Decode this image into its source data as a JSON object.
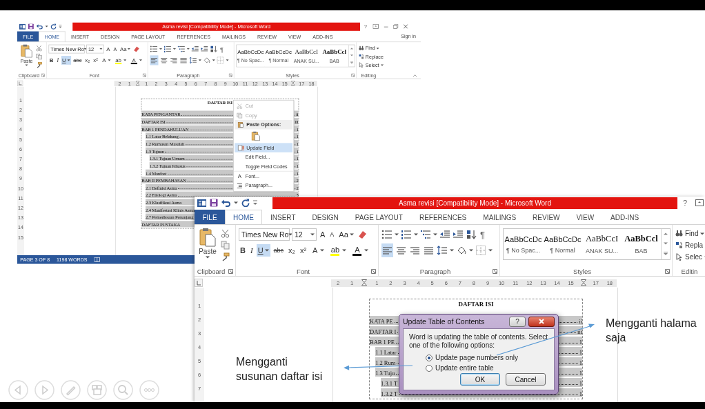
{
  "windows": [
    {
      "title": "Asma revisi [Compatibility Mode] - Microsoft Word",
      "help": "?",
      "sign_in": "Sign in",
      "tabs": [
        {
          "label": "FILE",
          "kind": "file",
          "selected": false
        },
        {
          "label": "HOME",
          "kind": "tab",
          "selected": true
        },
        {
          "label": "INSERT",
          "kind": "tab",
          "selected": false
        },
        {
          "label": "DESIGN",
          "kind": "tab",
          "selected": false
        },
        {
          "label": "PAGE LAYOUT",
          "kind": "tab",
          "selected": false
        },
        {
          "label": "REFERENCES",
          "kind": "tab",
          "selected": false
        },
        {
          "label": "MAILINGS",
          "kind": "tab",
          "selected": false
        },
        {
          "label": "REVIEW",
          "kind": "tab",
          "selected": false
        },
        {
          "label": "VIEW",
          "kind": "tab",
          "selected": false
        },
        {
          "label": "ADD-INS",
          "kind": "tab",
          "selected": false
        }
      ],
      "ribbon": {
        "paste": "Paste",
        "font_name": "Times New Ro",
        "font_size": "12",
        "size_buttons": [
          "A",
          "A"
        ],
        "case_button": "Aa",
        "format_buttons": [
          {
            "label": "B",
            "kind": "bold",
            "selected": false
          },
          {
            "label": "I",
            "kind": "italic",
            "selected": false
          },
          {
            "label": "U",
            "kind": "underline",
            "selected": true
          },
          {
            "label": "abc",
            "kind": "strike",
            "selected": false
          },
          {
            "label": "x₂",
            "kind": "subscript",
            "selected": false
          },
          {
            "label": "x²",
            "kind": "superscript",
            "selected": false
          }
        ],
        "color_buttons": [
          {
            "label": "A",
            "kind": "text-effect"
          },
          {
            "label": "ab",
            "kind": "highlight"
          },
          {
            "label": "A",
            "kind": "font-color"
          }
        ],
        "align_buttons": [
          {
            "kind": "left",
            "selected": true
          },
          {
            "kind": "center",
            "selected": false
          },
          {
            "kind": "right",
            "selected": false
          },
          {
            "kind": "justify",
            "selected": false
          }
        ],
        "show_marks": "¶",
        "styles": [
          {
            "preview": "AaBbCcDc",
            "name": "¶ No Spac...",
            "kind": "body"
          },
          {
            "preview": "AaBbCcDc",
            "name": "¶ Normal",
            "kind": "body"
          },
          {
            "preview": "AaBbCcI",
            "name": "ANAK SU...",
            "kind": "heading"
          },
          {
            "preview": "AaBbCcl",
            "name": "BAB",
            "kind": "heading-bold"
          }
        ],
        "editing": [
          {
            "label": "Find",
            "kind": "find"
          },
          {
            "label": "Replace",
            "kind": "replace"
          },
          {
            "label": "Select",
            "kind": "select"
          }
        ],
        "groups": [
          "Clipboard",
          "Font",
          "Paragraph",
          "Styles",
          "Editing"
        ]
      },
      "ruler": [
        {
          "kind": "number",
          "label": "2"
        },
        {
          "kind": "number",
          "label": "1"
        },
        {
          "kind": "marker"
        },
        {
          "kind": "number",
          "label": "1"
        },
        {
          "kind": "number",
          "label": "2"
        },
        {
          "kind": "number",
          "label": "3"
        },
        {
          "kind": "number",
          "label": "4"
        },
        {
          "kind": "number",
          "label": "5"
        },
        {
          "kind": "number",
          "label": "6"
        },
        {
          "kind": "number",
          "label": "7"
        },
        {
          "kind": "number",
          "label": "8"
        },
        {
          "kind": "number",
          "label": "9"
        },
        {
          "kind": "number",
          "label": "10"
        },
        {
          "kind": "number",
          "label": "11"
        },
        {
          "kind": "number",
          "label": "12"
        },
        {
          "kind": "number",
          "label": "13"
        },
        {
          "kind": "number",
          "label": "14"
        },
        {
          "kind": "number",
          "label": "15"
        },
        {
          "kind": "marker"
        },
        {
          "kind": "number",
          "label": "17"
        },
        {
          "kind": "number",
          "label": "18"
        }
      ],
      "vruler": [
        "1",
        "2",
        "3",
        "4",
        "5",
        "6",
        "7",
        "8",
        "9",
        "10",
        "11",
        "12",
        "13",
        "14",
        "15"
      ],
      "document": {
        "heading": "DAFTAR ISI",
        "entries": [
          {
            "text": "KATA PENGANTAR",
            "page": "ii"
          },
          {
            "text": "DAFTAR ISI",
            "page": "iii"
          },
          {
            "text": "BAB 1 PENDAHULUAN",
            "page": "1",
            "children": [
              {
                "text": "1.1 Latar Belakang",
                "page": "1"
              },
              {
                "text": "1.2 Rumusan Masalah",
                "page": "1"
              },
              {
                "text": "1.3 Tujuan",
                "page": "1",
                "children": [
                  {
                    "text": "1.3.1 Tujuan Umum",
                    "page": "1"
                  },
                  {
                    "text": "1.3.2 Tujuan Khusus",
                    "page": "1"
                  }
                ]
              },
              {
                "text": "1.4 Manfaat",
                "page": "1"
              }
            ]
          },
          {
            "text": "BAB II PEMBAHASAN",
            "page": "2",
            "children": [
              {
                "text": "2.1 Definisi Asma",
                "page": "2"
              },
              {
                "text": "2.2 Etiologi Asma",
                "page": "3"
              },
              {
                "text": "2.3 Klasifikasi Asma"
              },
              {
                "text": "2.4 Manifestasi Klinis Asma"
              },
              {
                "text": "2.7 Pemeriksaan Penunjang"
              }
            ]
          },
          {
            "text": "DAFTAR PUSTAKA"
          }
        ]
      },
      "context_menu": [
        {
          "label": "Cut",
          "kind": "cut",
          "disabled": true,
          "selected": false
        },
        {
          "label": "Copy",
          "kind": "copy",
          "disabled": true,
          "selected": false
        },
        {
          "label": "Paste Options:",
          "kind": "header",
          "disabled": false,
          "selected": false
        },
        {
          "kind": "paste-option",
          "disabled": false,
          "selected": false
        },
        {
          "label": "Update Field",
          "kind": "update-field",
          "disabled": false,
          "selected": true
        },
        {
          "label": "Edit Field...",
          "kind": "edit-field",
          "disabled": false,
          "selected": false
        },
        {
          "label": "Toggle Field Codes",
          "kind": "toggle",
          "disabled": false,
          "selected": false
        },
        {
          "label": "Font...",
          "kind": "font",
          "icon_text": "A",
          "disabled": false,
          "selected": false
        },
        {
          "label": "Paragraph...",
          "kind": "paragraph",
          "disabled": false,
          "selected": false
        }
      ],
      "status_bar": {
        "page": "PAGE 3 OF 8",
        "words": "1198 WORDS"
      }
    },
    {
      "title": "Asma revisi [Compatibility Mode] - Microsoft Word",
      "help": "?",
      "tabs": [
        {
          "label": "FILE",
          "kind": "file",
          "selected": false
        },
        {
          "label": "HOME",
          "kind": "tab",
          "selected": true
        },
        {
          "label": "INSERT",
          "kind": "tab",
          "selected": false
        },
        {
          "label": "DESIGN",
          "kind": "tab",
          "selected": false
        },
        {
          "label": "PAGE LAYOUT",
          "kind": "tab",
          "selected": false
        },
        {
          "label": "REFERENCES",
          "kind": "tab",
          "selected": false
        },
        {
          "label": "MAILINGS",
          "kind": "tab",
          "selected": false
        },
        {
          "label": "REVIEW",
          "kind": "tab",
          "selected": false
        },
        {
          "label": "VIEW",
          "kind": "tab",
          "selected": false
        },
        {
          "label": "ADD-INS",
          "kind": "tab",
          "selected": false
        }
      ],
      "ribbon": {
        "paste": "Paste",
        "font_name": "Times New Ro",
        "font_size": "12",
        "size_buttons": [
          "A",
          "A"
        ],
        "case_button": "Aa",
        "format_buttons": [
          {
            "label": "B",
            "kind": "bold",
            "selected": false
          },
          {
            "label": "I",
            "kind": "italic",
            "selected": false
          },
          {
            "label": "U",
            "kind": "underline",
            "selected": true
          },
          {
            "label": "abc",
            "kind": "strike",
            "selected": false
          },
          {
            "label": "x₂",
            "kind": "subscript",
            "selected": false
          },
          {
            "label": "x²",
            "kind": "superscript",
            "selected": false
          }
        ],
        "color_buttons": [
          {
            "label": "A",
            "kind": "text-effect"
          },
          {
            "label": "ab",
            "kind": "highlight"
          },
          {
            "label": "A",
            "kind": "font-color"
          }
        ],
        "align_buttons": [
          {
            "kind": "left",
            "selected": true
          },
          {
            "kind": "center",
            "selected": false
          },
          {
            "kind": "right",
            "selected": false
          },
          {
            "kind": "justify",
            "selected": false
          }
        ],
        "show_marks": "¶",
        "styles": [
          {
            "preview": "AaBbCcDc",
            "name": "¶ No Spac...",
            "kind": "body"
          },
          {
            "preview": "AaBbCcDc",
            "name": "¶ Normal",
            "kind": "body"
          },
          {
            "preview": "AaBbCcI",
            "name": "ANAK SU...",
            "kind": "heading"
          },
          {
            "preview": "AaBbCcl",
            "name": "BAB",
            "kind": "heading-bold"
          }
        ],
        "editing": [
          {
            "label": "Find",
            "kind": "find"
          },
          {
            "label": "Repla",
            "kind": "replace"
          },
          {
            "label": "Selec",
            "kind": "select"
          }
        ],
        "groups": [
          "Clipboard",
          "Font",
          "Paragraph",
          "Styles",
          "Editin"
        ]
      },
      "ruler": [
        {
          "kind": "number",
          "label": "2"
        },
        {
          "kind": "number",
          "label": "1"
        },
        {
          "kind": "marker"
        },
        {
          "kind": "number",
          "label": "1"
        },
        {
          "kind": "number",
          "label": "2"
        },
        {
          "kind": "number",
          "label": "3"
        },
        {
          "kind": "number",
          "label": "4"
        },
        {
          "kind": "number",
          "label": "5"
        },
        {
          "kind": "number",
          "label": "6"
        },
        {
          "kind": "number",
          "label": "7"
        },
        {
          "kind": "number",
          "label": "8"
        },
        {
          "kind": "number",
          "label": "9"
        },
        {
          "kind": "number",
          "label": "10"
        },
        {
          "kind": "number",
          "label": "11"
        },
        {
          "kind": "number",
          "label": "12"
        },
        {
          "kind": "number",
          "label": "13"
        },
        {
          "kind": "number",
          "label": "14"
        },
        {
          "kind": "number",
          "label": "15"
        },
        {
          "kind": "marker"
        },
        {
          "kind": "number",
          "label": "17"
        },
        {
          "kind": "number",
          "label": "18"
        }
      ],
      "vruler": [
        "1",
        "2",
        "3",
        "4",
        "5",
        "6",
        "7"
      ],
      "document": {
        "heading": "DAFTAR ISI",
        "entries": [
          {
            "text": "KATA PE",
            "page": "ii"
          },
          {
            "text": "DAFTAR I",
            "page": "iii"
          },
          {
            "text": "BAB 1 PE",
            "page": "1",
            "children": [
              {
                "text": "1.1 Latar",
                "page": "1"
              },
              {
                "text": "1.2 Rum",
                "page": "1"
              },
              {
                "text": "1.3 Tuju",
                "page": "1",
                "children": [
                  {
                    "text": "1.3.1 T",
                    "page": "1"
                  },
                  {
                    "text": "1.3.2 T",
                    "page": "1"
                  }
                ]
              }
            ]
          }
        ]
      },
      "dialog": {
        "title": "Update Table of Contents",
        "help": "?",
        "message": "Word is updating the table of contents.  Select one of the following options:",
        "options": [
          {
            "label": "Update page numbers only",
            "selected": true
          },
          {
            "label": "Update entire table",
            "selected": false
          }
        ],
        "buttons": [
          {
            "label": "OK",
            "kind": "default"
          },
          {
            "label": "Cancel",
            "kind": "normal"
          }
        ]
      }
    }
  ],
  "annotations": [
    {
      "lines": [
        "Mengganti halama",
        "saja"
      ],
      "kind": "right"
    },
    {
      "lines": [
        "Mengganti",
        "susunan daftar isi"
      ],
      "kind": "left"
    }
  ]
}
